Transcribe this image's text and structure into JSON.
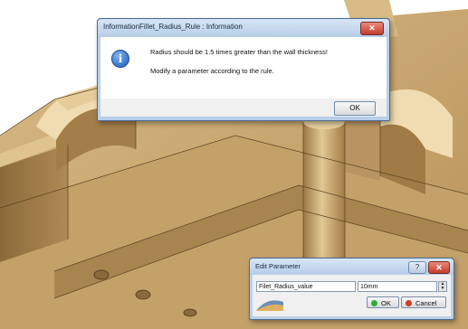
{
  "info_dialog": {
    "title": "InformationFillet_Radius_Rule : Information",
    "close_glyph": "✕",
    "message_line1": "Radius should be 1.5 times greater than the wall thickness!",
    "message_line2": "Modify a parameter according to the rule.",
    "icon": "info-icon",
    "ok_label": "OK"
  },
  "edit_parameter": {
    "title": "Edit Parameter",
    "help_glyph": "?",
    "close_glyph": "✕",
    "parameter_name": "Filet_Radius_value",
    "parameter_value": "10mm",
    "ok_label": "OK",
    "cancel_label": "Cancel"
  },
  "colors": {
    "model_face": "#c9a66e",
    "model_shadow": "#8a6a3a",
    "ok_dot": "#2fae3a",
    "cancel_dot": "#d23a2a"
  }
}
